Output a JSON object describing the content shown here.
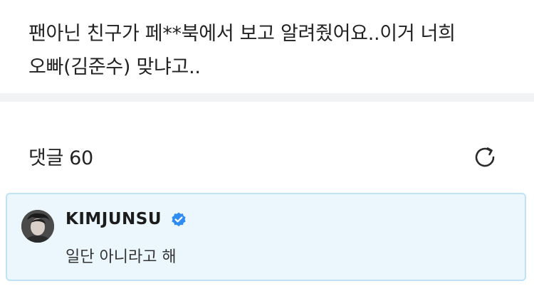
{
  "post": {
    "body_line1": "팬아닌 친구가 페**북에서 보고 알려줬어요..이거 너희",
    "body_line2": "오빠(김준수) 맞냐고.."
  },
  "comments": {
    "label": "댓글",
    "count": "60",
    "refresh_icon": "refresh-icon"
  },
  "highlighted_comment": {
    "author": "KIMJUNSU",
    "verified_icon": "verified-badge-icon",
    "text": "일단 아니라고 해"
  },
  "colors": {
    "card_bg": "#ecf7fd",
    "card_border": "#bfe3f5",
    "verified": "#2f8cf0",
    "separator": "#f2f3f5"
  }
}
